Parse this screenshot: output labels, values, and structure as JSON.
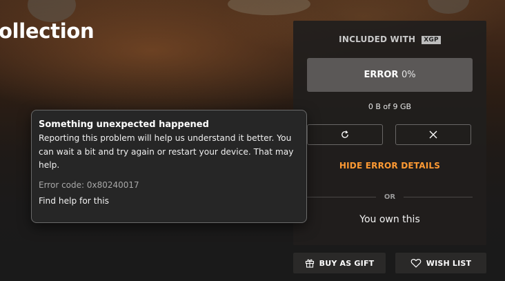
{
  "game": {
    "title_partial": "ollection"
  },
  "panel": {
    "included_label": "INCLUDED WITH",
    "included_badge": "XGP",
    "status_label": "ERROR",
    "status_percent": "0%",
    "progress": 0,
    "size_text": "0 B of 9 GB",
    "retry_icon": "retry-icon",
    "cancel_icon": "close-icon",
    "hide_details_label": "HIDE ERROR DETAILS",
    "or_label": "OR",
    "ownership_text": "You own this",
    "accent_color": "#ff9a33"
  },
  "actions": {
    "gift_label": "BUY AS GIFT",
    "gift_icon": "gift-icon",
    "wishlist_label": "WISH LIST",
    "wishlist_icon": "heart-icon"
  },
  "error_flyout": {
    "title": "Something unexpected happened",
    "body": "Reporting this problem will help us understand it better. You can wait a bit and try again or restart your device. That may help.",
    "code": "Error code: 0x80240017",
    "help_link": "Find help for this"
  }
}
